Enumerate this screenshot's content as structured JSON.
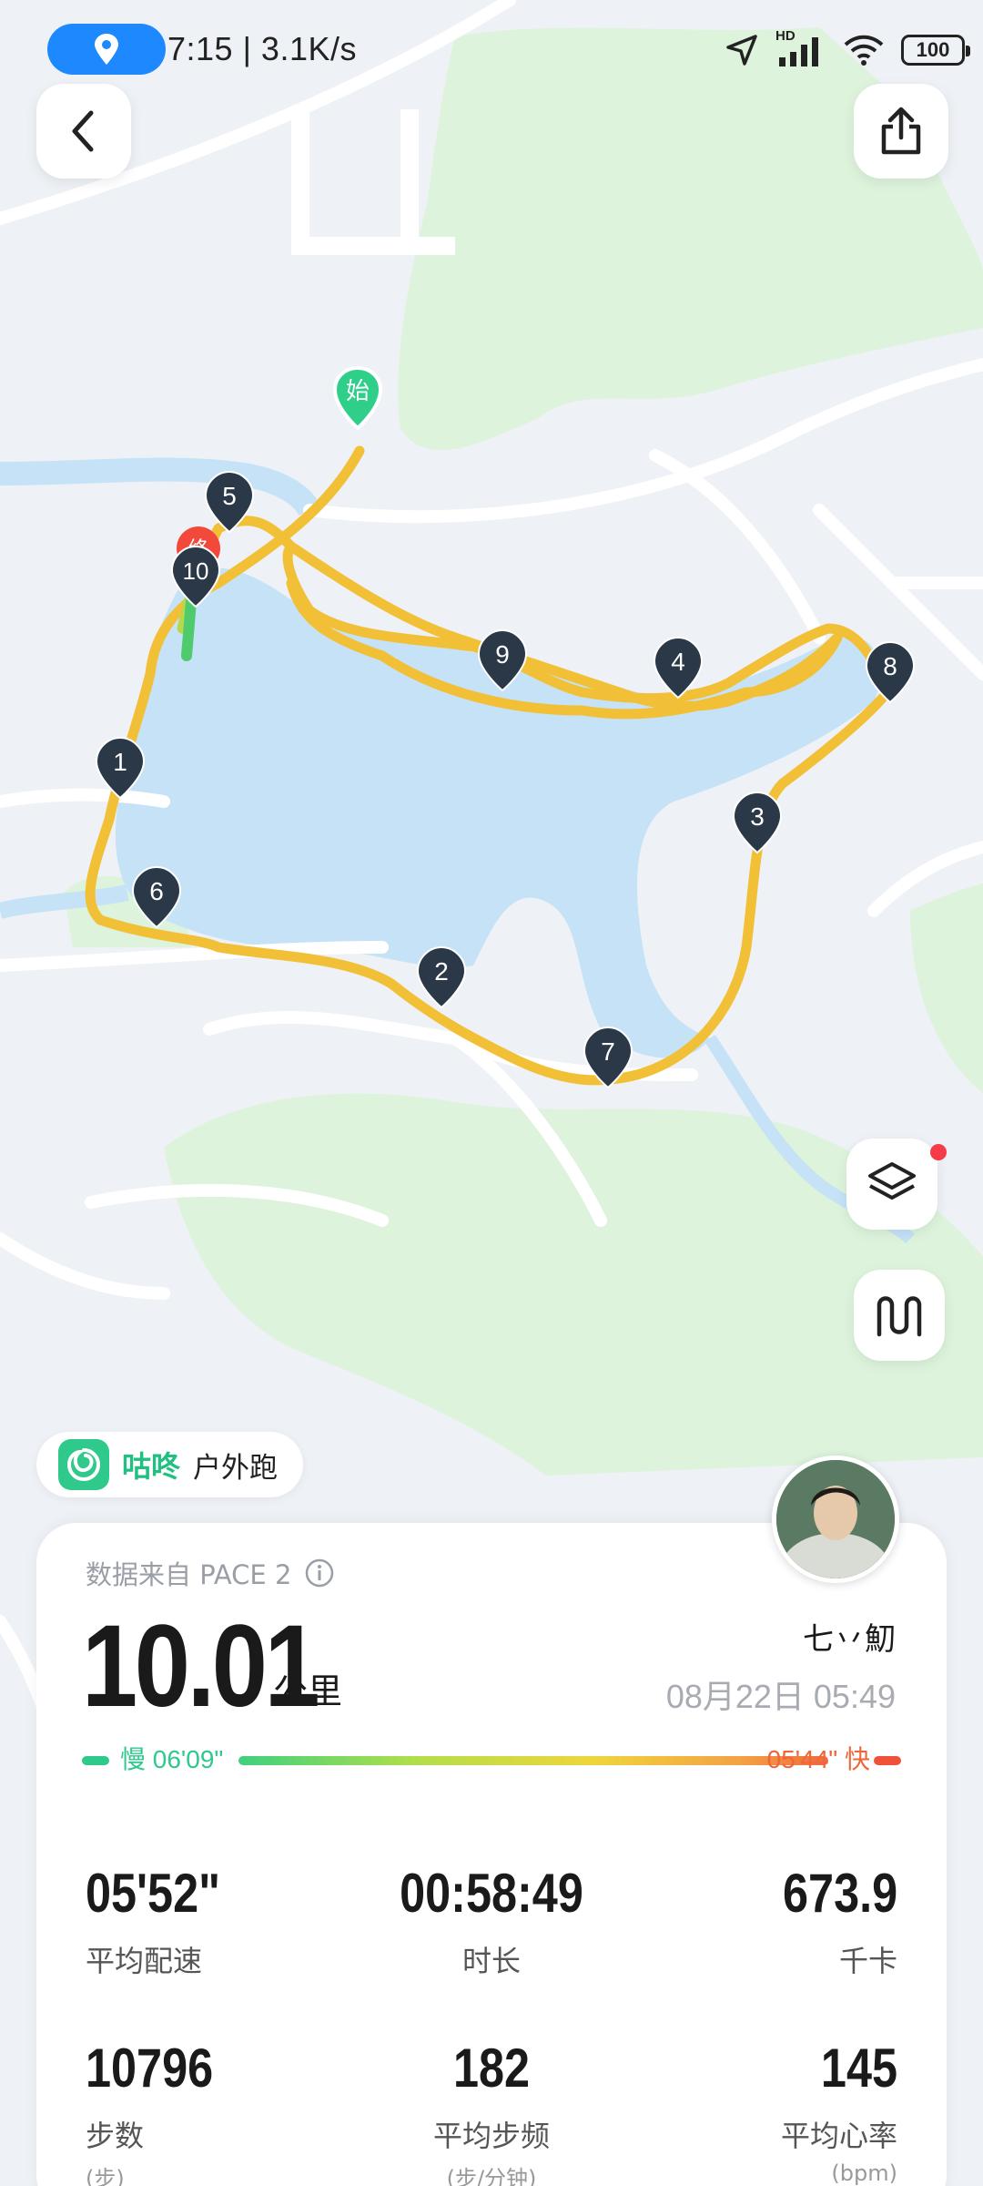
{
  "status_bar": {
    "time_speed": "7:15 | 3.1K/s",
    "network": "HD",
    "battery": "100"
  },
  "map": {
    "start_label": "始",
    "end_label": "终",
    "markers": [
      "1",
      "2",
      "3",
      "4",
      "5",
      "6",
      "7",
      "8",
      "9",
      "10"
    ],
    "colors": {
      "route": "#f2c037",
      "water": "#c5e2f7",
      "park": "#ddf3dc",
      "marker": "#2a3848",
      "start": "#2fcf8a",
      "end": "#f2493b"
    }
  },
  "app": {
    "name": "咕咚",
    "activity": "户外跑"
  },
  "summary": {
    "source": "数据来自 PACE 2",
    "distance": "10.01",
    "distance_unit": "公里",
    "user": "七丷魛",
    "datetime": "08月22日 05:49"
  },
  "pace": {
    "slow_label": "慢 06'09\"",
    "fast_label": "05'44\" 快"
  },
  "stats": {
    "avg_pace": {
      "value": "05'52\"",
      "label": "平均配速"
    },
    "duration": {
      "value": "00:58:49",
      "label": "时长"
    },
    "calories": {
      "value": "673.9",
      "label": "千卡"
    },
    "steps": {
      "value": "10796",
      "label": "步数",
      "unit": "(步)"
    },
    "cadence": {
      "value": "182",
      "label": "平均步频",
      "unit": "(步/分钟)"
    },
    "heart_rate": {
      "value": "145",
      "label": "平均心率",
      "unit": "(bpm)"
    }
  }
}
